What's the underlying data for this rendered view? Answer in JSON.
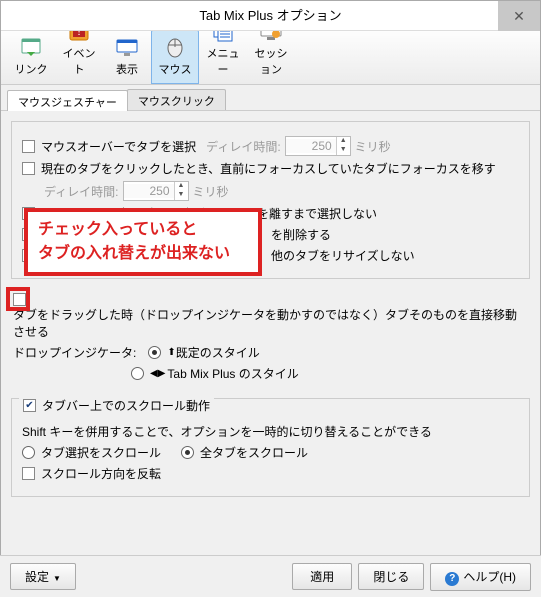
{
  "window": {
    "title": "Tab Mix Plus オプション",
    "close_glyph": "✕"
  },
  "toolbar": {
    "items": [
      {
        "label": "リンク"
      },
      {
        "label": "イベント"
      },
      {
        "label": "表示"
      },
      {
        "label": "マウス"
      },
      {
        "label": "メニュー"
      },
      {
        "label": "セッション"
      }
    ],
    "active_index": 3
  },
  "tabs": {
    "items": [
      "マウスジェスチャー",
      "マウスクリック"
    ],
    "active_index": 0
  },
  "gesture": {
    "cb_hover_select": "マウスオーバーでタブを選択",
    "delay_label": "ディレイ時間:",
    "delay_value_1": "250",
    "delay_unit": "ミリ秒",
    "cb_click_focus": "現在のタブをクリックしたとき、直前にフォーカスしていたタブにフォーカスを移す",
    "delay_value_2": "250",
    "cb_click_select_partial": "クリックでタブを選択する場合、ボタンを離すまで選択しない",
    "cb_del_suffix": "を削除する",
    "cb_resize_suffix": "他のタブをリサイズしない",
    "callout_line1": "チェック入っていると",
    "callout_line2": "タブの入れ替えが出来ない",
    "cb_drag_move": "タブをドラッグした時（ドロップインジケータを動かすのではなく）タブそのものを直接移動させる",
    "drop_label": "ドロップインジケータ:",
    "radio_default": "既定のスタイル",
    "radio_tmp": "Tab Mix Plus のスタイル",
    "drop_radio_index": 0
  },
  "scroll": {
    "legend": "タブバー上でのスクロール動作",
    "legend_checked": true,
    "hint": "Shift キーを併用することで、オプションを一時的に切り替えることができる",
    "radio_sel": "タブ選択をスクロール",
    "radio_all": "全タブをスクロール",
    "radio_index": 1,
    "cb_reverse": "スクロール方向を反転"
  },
  "footer": {
    "settings": "設定",
    "apply": "適用",
    "close": "閉じる",
    "help": "ヘルプ(H)"
  }
}
